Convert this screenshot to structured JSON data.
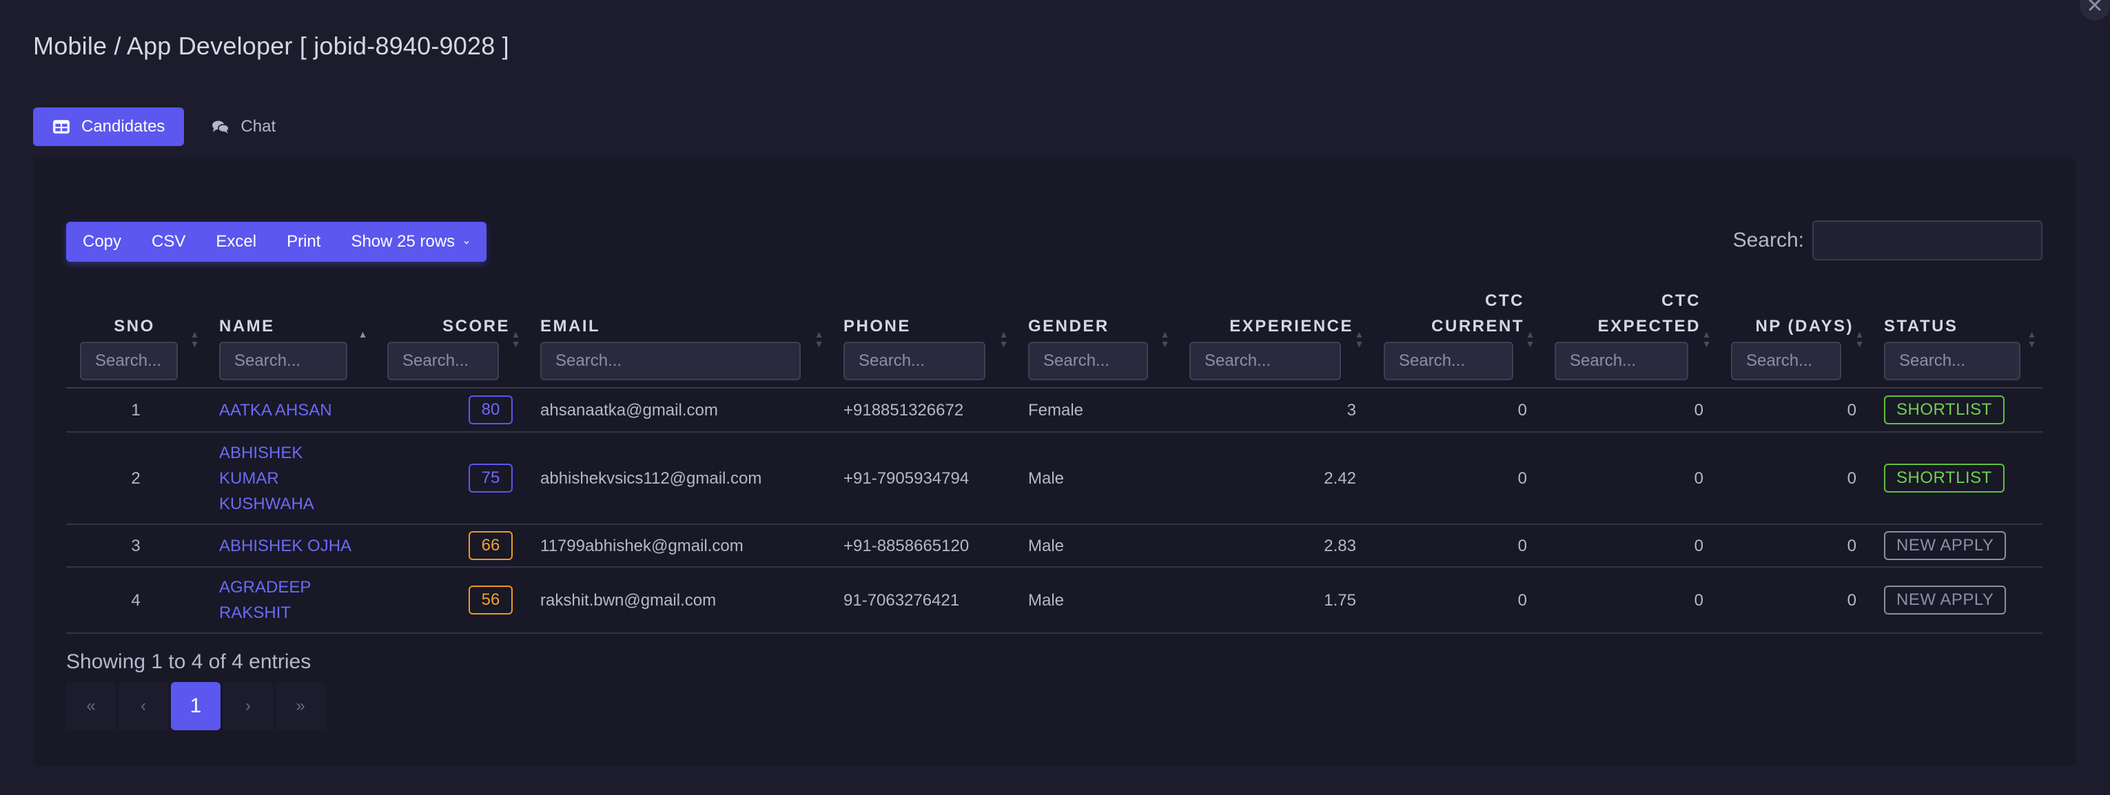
{
  "page": {
    "title": "Mobile / App Developer [ jobid-8940-9028 ]",
    "close_icon": "close-icon",
    "accent_color": "#5b57ef"
  },
  "tabs": [
    {
      "label": "Candidates",
      "icon": "table-icon",
      "active": true
    },
    {
      "label": "Chat",
      "icon": "chat-bubbles-icon",
      "active": false
    }
  ],
  "toolbar": {
    "copy": "Copy",
    "csv": "CSV",
    "excel": "Excel",
    "print": "Print",
    "show_rows": "Show 25 rows",
    "search_label": "Search:",
    "search_value": ""
  },
  "columns": [
    {
      "key": "sno",
      "label": "SNO",
      "placeholder": "Search..."
    },
    {
      "key": "name",
      "label": "NAME",
      "placeholder": "Search...",
      "sorted": "asc"
    },
    {
      "key": "score",
      "label": "SCORE",
      "placeholder": "Search..."
    },
    {
      "key": "email",
      "label": "EMAIL",
      "placeholder": "Search..."
    },
    {
      "key": "phone",
      "label": "PHONE",
      "placeholder": "Search..."
    },
    {
      "key": "gender",
      "label": "GENDER",
      "placeholder": "Search..."
    },
    {
      "key": "experience",
      "label": "EXPERIENCE",
      "placeholder": "Search..."
    },
    {
      "key": "ctc_current",
      "label_line1": "CTC",
      "label_line2": "CURRENT",
      "placeholder": "Search..."
    },
    {
      "key": "ctc_expected",
      "label_line1": "CTC",
      "label_line2": "EXPECTED",
      "placeholder": "Search..."
    },
    {
      "key": "np_days",
      "label": "NP (DAYS)",
      "placeholder": "Search..."
    },
    {
      "key": "status",
      "label": "STATUS",
      "placeholder": "Search..."
    }
  ],
  "rows": [
    {
      "sno": "1",
      "name_lines": [
        "AATKA AHSAN"
      ],
      "score": "80",
      "score_color": "#5b57ef",
      "email": "ahsanaatka@gmail.com",
      "phone": "+918851326672",
      "gender": "Female",
      "experience": "3",
      "ctc_current": "0",
      "ctc_expected": "0",
      "np_days": "0",
      "status": "SHORTLIST",
      "status_color": "#62c23d"
    },
    {
      "sno": "2",
      "name_lines": [
        "ABHISHEK",
        "KUMAR",
        "KUSHWAHA"
      ],
      "score": "75",
      "score_color": "#5b57ef",
      "email": "abhishekvsics112@gmail.com",
      "phone": "+91-7905934794",
      "gender": "Male",
      "experience": "2.42",
      "ctc_current": "0",
      "ctc_expected": "0",
      "np_days": "0",
      "status": "SHORTLIST",
      "status_color": "#62c23d"
    },
    {
      "sno": "3",
      "name_lines": [
        "ABHISHEK OJHA"
      ],
      "score": "66",
      "score_color": "#e89a21",
      "email": "11799abhishek@gmail.com",
      "phone": "+91-8858665120",
      "gender": "Male",
      "experience": "2.83",
      "ctc_current": "0",
      "ctc_expected": "0",
      "np_days": "0",
      "status": "NEW APPLY",
      "status_color": "#8d8ea6"
    },
    {
      "sno": "4",
      "name_lines": [
        "AGRADEEP",
        "RAKSHIT"
      ],
      "score": "56",
      "score_color": "#e89a21",
      "email": "rakshit.bwn@gmail.com",
      "phone": "91-7063276421",
      "gender": "Male",
      "experience": "1.75",
      "ctc_current": "0",
      "ctc_expected": "0",
      "np_days": "0",
      "status": "NEW APPLY",
      "status_color": "#8d8ea6"
    }
  ],
  "footer": {
    "info": "Showing 1 to 4 of 4 entries",
    "pager": {
      "first": "«",
      "prev": "‹",
      "current": "1",
      "next": "›",
      "last": "»"
    }
  }
}
